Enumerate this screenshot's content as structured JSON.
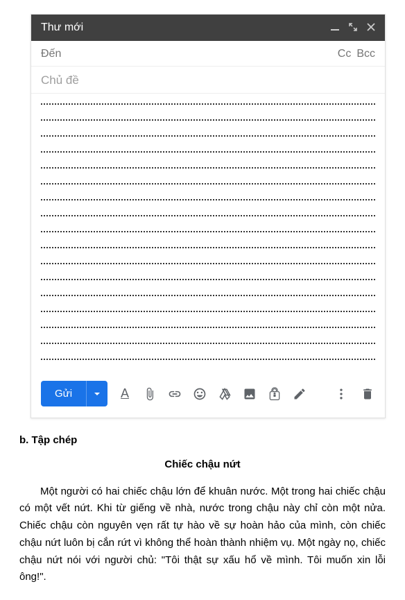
{
  "compose": {
    "title": "Thư mới",
    "to_label": "Đến",
    "cc_label": "Cc",
    "bcc_label": "Bcc",
    "subject_placeholder": "Chủ đề",
    "line_count": 17,
    "send_label": "Gửi",
    "icons": {
      "minimize": "minimize",
      "expand": "expand",
      "close": "close",
      "format": "A",
      "attach": "attach",
      "link": "link",
      "emoji": "emoji",
      "drive": "drive",
      "photo": "photo",
      "confidential": "confidential",
      "pen": "pen",
      "more": "more",
      "trash": "trash"
    }
  },
  "article": {
    "section": "b. Tập chép",
    "title": "Chiếc chậu nứt",
    "body": "Một người có hai chiếc chậu lớn để khuân nước. Một trong hai chiếc chậu có một vết nứt. Khi từ giếng về nhà, nước trong chậu này chỉ còn một nửa. Chiếc chậu còn nguyên vẹn rất tự hào về sự hoàn hảo của mình, còn chiếc chậu nứt luôn bị cắn rứt vì không thể hoàn thành nhiệm vụ. Một ngày nọ, chiếc chậu nứt nói với người chủ: \"Tôi thật sự xấu hổ về mình. Tôi muốn xin lỗi ông!\"."
  }
}
